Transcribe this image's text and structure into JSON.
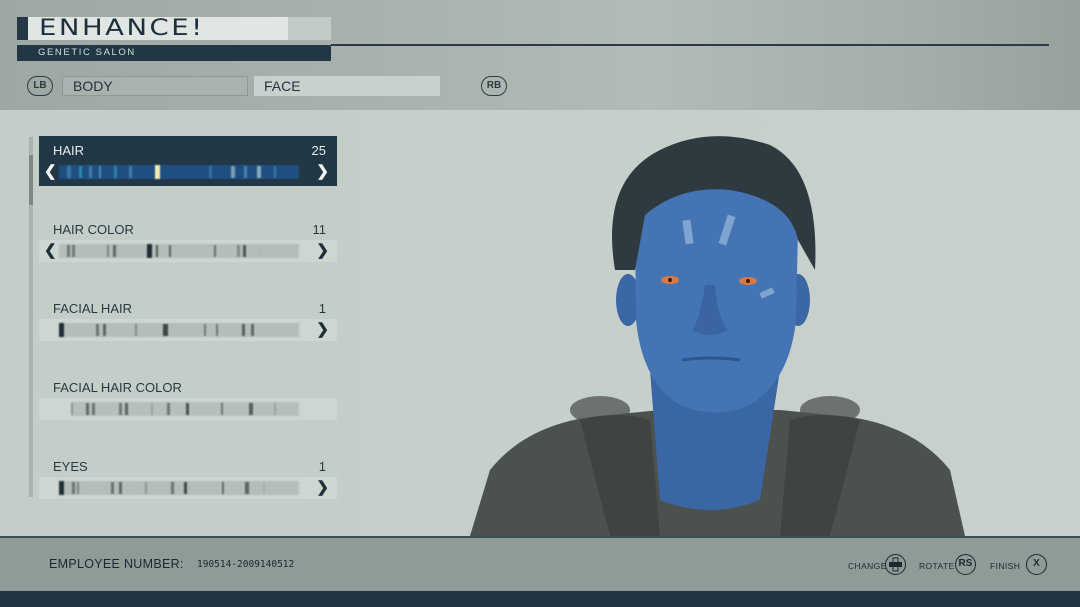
{
  "header": {
    "title": "ENHANCE!",
    "subtitle": "GENETIC SALON",
    "left_bumper": "LB",
    "right_bumper": "RB",
    "tabs": [
      {
        "label": "BODY",
        "active": false
      },
      {
        "label": "FACE",
        "active": true
      }
    ]
  },
  "options": [
    {
      "label": "HAIR",
      "value": "25",
      "selected": true,
      "has_left_arrow": true,
      "has_right_arrow": true,
      "position": 0.42
    },
    {
      "label": "HAIR COLOR",
      "value": "11",
      "selected": false,
      "has_left_arrow": true,
      "has_right_arrow": true,
      "position": 0.45
    },
    {
      "label": "FACIAL HAIR",
      "value": "1",
      "selected": false,
      "has_left_arrow": false,
      "has_right_arrow": true,
      "position": 0.0
    },
    {
      "label": "FACIAL HAIR COLOR",
      "value": "",
      "selected": false,
      "has_left_arrow": false,
      "has_right_arrow": false,
      "position": null
    },
    {
      "label": "EYES",
      "value": "1",
      "selected": false,
      "has_left_arrow": false,
      "has_right_arrow": true,
      "position": 0.0
    }
  ],
  "scroll": {
    "position_fraction": 0.05
  },
  "portrait": {
    "subject": "blue-skinned male character with dark slicked-back hair, orange eyes, wearing dark armored suit"
  },
  "footer": {
    "employee_label": "EMPLOYEE NUMBER:",
    "employee_number": "190514-2009140512",
    "hints": [
      {
        "label": "CHANGE",
        "button": "✥",
        "icon": "dpad-icon"
      },
      {
        "label": "ROTATE",
        "button": "RS",
        "icon": "right-stick-icon"
      },
      {
        "label": "FINISH",
        "button": "X",
        "icon": "x-button-icon"
      }
    ]
  },
  "colors": {
    "accent_dark": "#223746",
    "selected_highlight": "#f3e7a6",
    "skin_blue": "#3f6eae"
  }
}
